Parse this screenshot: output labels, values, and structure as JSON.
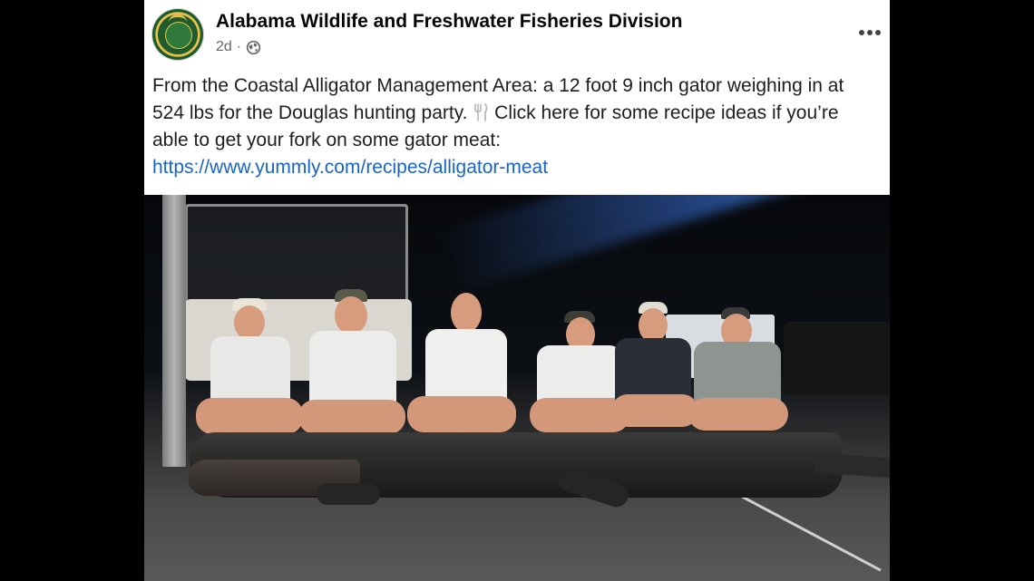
{
  "post": {
    "page_name": "Alabama Wildlife and Freshwater Fisheries Division",
    "time": "2d",
    "separator": "·",
    "caption": {
      "line1": "From the Coastal Alligator Management Area: a 12 foot 9 inch gator weighing in at",
      "line2_before_icon": "524 lbs for the Douglas hunting party. ",
      "line2_after_icon": " Click here for some recipe ideas if you’re",
      "line3": "able to get your fork on some gator meat:",
      "link": "https://www.yummly.com/recipes/alligator-meat"
    },
    "icons": {
      "avatar": "agency-seal-logo",
      "audience": "globe-icon",
      "menu": "more-options-icon",
      "fork": "fork-and-knife-icon"
    },
    "colors": {
      "link": "#1a64c7",
      "meta": "#65676b",
      "text": "#1c1e21",
      "frame": "#000000"
    }
  }
}
